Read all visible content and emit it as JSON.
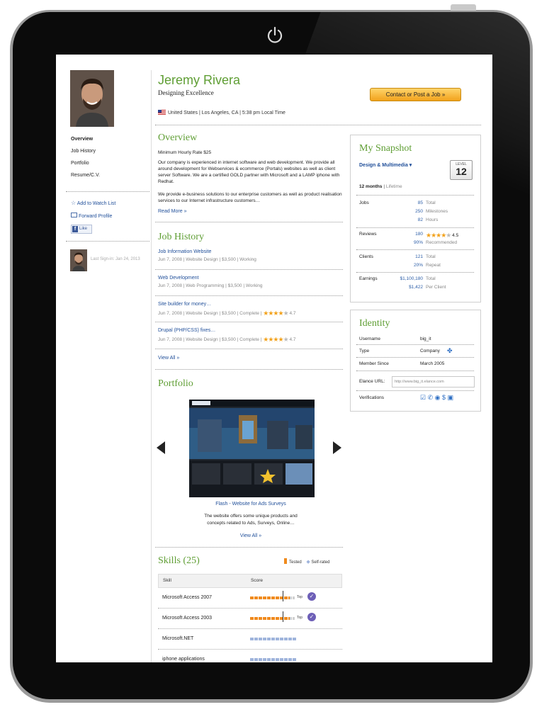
{
  "profile": {
    "name": "Jeremy Rivera",
    "tagline": "Designing Excellence",
    "location_country": "United States",
    "location_city": "Los Angeles, CA",
    "local_time": "5:38 pm Local Time",
    "contact_button": "Contact or Post a Job »"
  },
  "left_nav": {
    "items": [
      "Overview",
      "Job History",
      "Portfolio",
      "Resume/C.V."
    ],
    "watch_list": "Add to Watch List",
    "forward": "Forward Profile",
    "like": "Like",
    "last_sign_in": "Last Sign-in: Jan 24, 2013"
  },
  "overview": {
    "heading": "Overview",
    "min_rate": "Minimum Hourly Rate $25",
    "para1": "Our company is experienced in internet software and web development. We provide all around development for Webservices & ecommerce (Portals) websites as well as client server Software. We are a certified GOLD partner with Microsoft and a LAMP iphone with Redhat.",
    "para2": "We provide e-business solutions to our enterprise customers as well as product realisation services to our Internet infrastructure customers…",
    "read_more": "Read More »"
  },
  "job_history": {
    "heading": "Job History",
    "jobs": [
      {
        "title": "Job Information Website",
        "meta": "Jun 7, 2008  | Website Design  | $3,500 | Working",
        "rating": ""
      },
      {
        "title": "Web Development",
        "meta": "Jun 7, 2008  | Web Programming  | $3,500  | Working",
        "rating": ""
      },
      {
        "title": "Site builder for money…",
        "meta": "Jun 7, 2008  | Website Design  | $3,500 | Complete  |",
        "rating": "4.7"
      },
      {
        "title": "Drupal (PHP/CSS) fixes…",
        "meta": "Jun 7, 2008  | Website Design  | $3,500 | Complete  |",
        "rating": "4.7"
      }
    ],
    "view_all": "View All »"
  },
  "portfolio": {
    "heading": "Portfolio",
    "item_title": "Flash - Website for Ads Surveys",
    "item_desc_1": "The website offers some unique products and",
    "item_desc_2": "concepts related to Ads, Surveys, Online…",
    "view_all": "View All »"
  },
  "skills": {
    "heading": "Skills (25)",
    "legend_tested": "Tested",
    "legend_self": "Self-rated",
    "col_skill": "Skill",
    "col_score": "Score",
    "top_label": "Top",
    "rows": [
      {
        "name": "Microsoft Access 2007",
        "kind": "tested"
      },
      {
        "name": "Microsoft Access 2003",
        "kind": "tested"
      },
      {
        "name": "Microsoft.NET",
        "kind": "self"
      },
      {
        "name": "iphone applications",
        "kind": "self"
      }
    ]
  },
  "snapshot": {
    "heading": "My Snapshot",
    "category": "Design & Multimedia ▾",
    "level_label": "LEVEL",
    "level": "12",
    "period_active": "12 months",
    "period_other": "Lifetime",
    "jobs_label": "Jobs",
    "jobs": [
      [
        "85",
        "Total"
      ],
      [
        "250",
        "Milestones"
      ],
      [
        "82",
        "Hours"
      ]
    ],
    "reviews_label": "Reviews",
    "reviews_count": "180",
    "reviews_rating": "4.5",
    "reviews_pct": "90%",
    "reviews_pct_label": "Recommended",
    "clients_label": "Clients",
    "clients": [
      [
        "121",
        "Total"
      ],
      [
        "20%",
        "Repeat"
      ]
    ],
    "earnings_label": "Earnings",
    "earnings": [
      [
        "$1,100,180",
        "Total"
      ],
      [
        "$1,422",
        "Per Client"
      ]
    ]
  },
  "identity": {
    "heading": "Identity",
    "username_label": "Username",
    "username": "big_it",
    "type_label": "Type",
    "type": "Company",
    "member_label": "Member Since",
    "member_since": "March 2005",
    "url_label": "Elance URL:",
    "url_value": "http://www.big_it.elance.com",
    "verifications_label": "Verifications"
  },
  "colors": {
    "accent_green": "#5f9e34",
    "link_blue": "#1f4e99",
    "tested_orange": "#f08a1c",
    "self_rated_blue": "#9fb4dc"
  }
}
